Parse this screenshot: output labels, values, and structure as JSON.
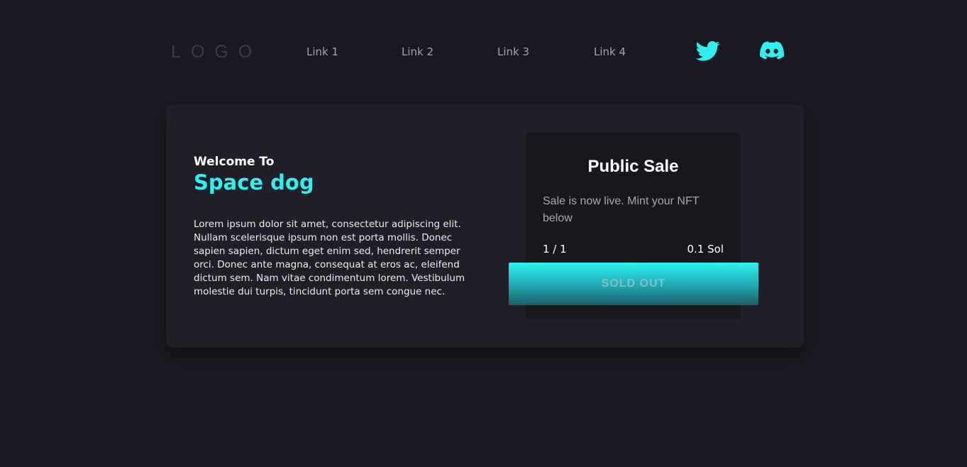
{
  "nav": {
    "logo": "LOGO",
    "links": [
      {
        "label": "Link 1"
      },
      {
        "label": "Link 2"
      },
      {
        "label": "Link 3"
      },
      {
        "label": "Link 4"
      }
    ],
    "social": [
      {
        "icon": "twitter-icon",
        "color": "#2ef0f0"
      },
      {
        "icon": "discord-icon",
        "color": "#2ef0f0"
      }
    ]
  },
  "hero": {
    "welcome": "Welcome To",
    "brand": "Space dog",
    "description": "Lorem ipsum dolor sit amet, consectetur adipiscing elit. Nullam scelerisque ipsum non est porta mollis. Donec sapien sapien, dictum eget enim sed, hendrerit semper orci. Donec ante magna, consequat at eros ac, eleifend dictum sem. Nam vitae condimentum lorem. Vestibulum molestie dui turpis, tincidunt porta sem congue nec."
  },
  "sale": {
    "title": "Public Sale",
    "subtitle": "Sale is now live. Mint your NFT below",
    "count": "1 / 1",
    "price": "0.1 Sol",
    "button_label": "SOLD OUT"
  },
  "colors": {
    "background": "#1a1921",
    "card": "#201f28",
    "accent": "#2ef0f0",
    "panel": "#16181d"
  }
}
